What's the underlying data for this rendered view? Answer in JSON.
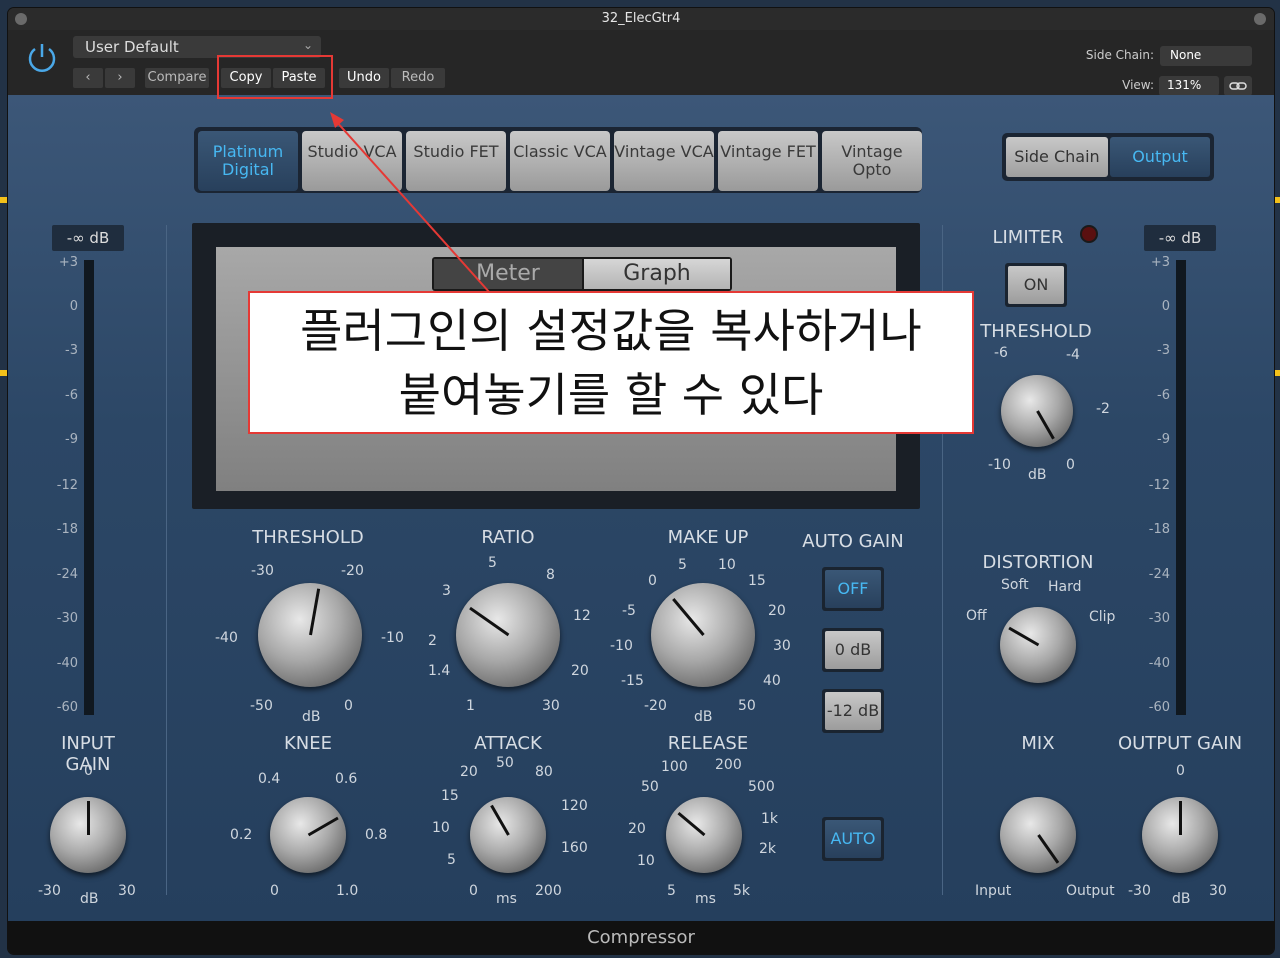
{
  "window": {
    "title": "32_ElecGtr4"
  },
  "header": {
    "preset": "User Default",
    "compare": "Compare",
    "copy": "Copy",
    "paste": "Paste",
    "undo": "Undo",
    "redo": "Redo",
    "side_chain_label": "Side Chain:",
    "side_chain_value": "None",
    "view_label": "View:",
    "view_value": "131%"
  },
  "tabs": [
    {
      "label": "Platinum Digital",
      "active": true
    },
    {
      "label": "Studio VCA"
    },
    {
      "label": "Studio FET"
    },
    {
      "label": "Classic VCA"
    },
    {
      "label": "Vintage VCA"
    },
    {
      "label": "Vintage FET"
    },
    {
      "label": "Vintage Opto"
    }
  ],
  "output_switch": {
    "side_chain": "Side Chain",
    "output": "Output"
  },
  "meters": {
    "input_readout": "-∞ dB",
    "output_readout": "-∞ dB",
    "scale": [
      "+3",
      "0",
      "-3",
      "-6",
      "-9",
      "-12",
      "-18",
      "-24",
      "-30",
      "-40",
      "-60"
    ]
  },
  "display": {
    "meter_tab": "Meter",
    "graph_tab": "Graph"
  },
  "limiter": {
    "label": "LIMITER",
    "on": "ON",
    "threshold_label": "THRESHOLD",
    "ticks": [
      "-6",
      "-4",
      "-2",
      "0",
      "-10",
      "dB"
    ]
  },
  "knobs": {
    "threshold": {
      "label": "THRESHOLD",
      "ticks": [
        "-30",
        "-20",
        "-40",
        "-10",
        "-50",
        "dB",
        "0"
      ]
    },
    "ratio": {
      "label": "RATIO",
      "ticks": [
        "5",
        "3",
        "8",
        "2",
        "12",
        "1.4",
        "20",
        "1",
        "30"
      ]
    },
    "makeup": {
      "label": "MAKE UP",
      "ticks": [
        "5",
        "10",
        "0",
        "15",
        "-5",
        "20",
        "-10",
        "30",
        "-15",
        "40",
        "-20",
        "dB",
        "50"
      ]
    },
    "knee": {
      "label": "KNEE",
      "ticks": [
        "0.4",
        "0.6",
        "0.2",
        "0.8",
        "0",
        "1.0"
      ]
    },
    "attack": {
      "label": "ATTACK",
      "ticks": [
        "50",
        "20",
        "80",
        "15",
        "120",
        "10",
        "160",
        "5",
        "0",
        "ms",
        "200"
      ]
    },
    "release": {
      "label": "RELEASE",
      "ticks": [
        "100",
        "200",
        "50",
        "500",
        "20",
        "1k",
        "10",
        "2k",
        "5",
        "ms",
        "5k"
      ]
    },
    "input_gain": {
      "label": "INPUT GAIN",
      "ticks": [
        "0",
        "-30",
        "dB",
        "30"
      ]
    },
    "output_gain": {
      "label": "OUTPUT GAIN",
      "ticks": [
        "0",
        "-30",
        "dB",
        "30"
      ]
    },
    "distortion": {
      "label": "DISTORTION",
      "ticks": [
        "Soft",
        "Hard",
        "Off",
        "Clip"
      ]
    },
    "mix": {
      "label": "MIX",
      "ticks": [
        "Input",
        "Output"
      ]
    }
  },
  "auto_gain": {
    "label": "AUTO GAIN",
    "off": "OFF",
    "zero": "0 dB",
    "minus12": "-12 dB",
    "auto": "AUTO"
  },
  "footer": "Compressor",
  "annotation": {
    "line1": "플러그인의 설정값을 복사하거나",
    "line2": "붙여놓기를 할 수 있다"
  },
  "colors": {
    "accent": "#47b8f2",
    "annotation_red": "#e53935"
  }
}
